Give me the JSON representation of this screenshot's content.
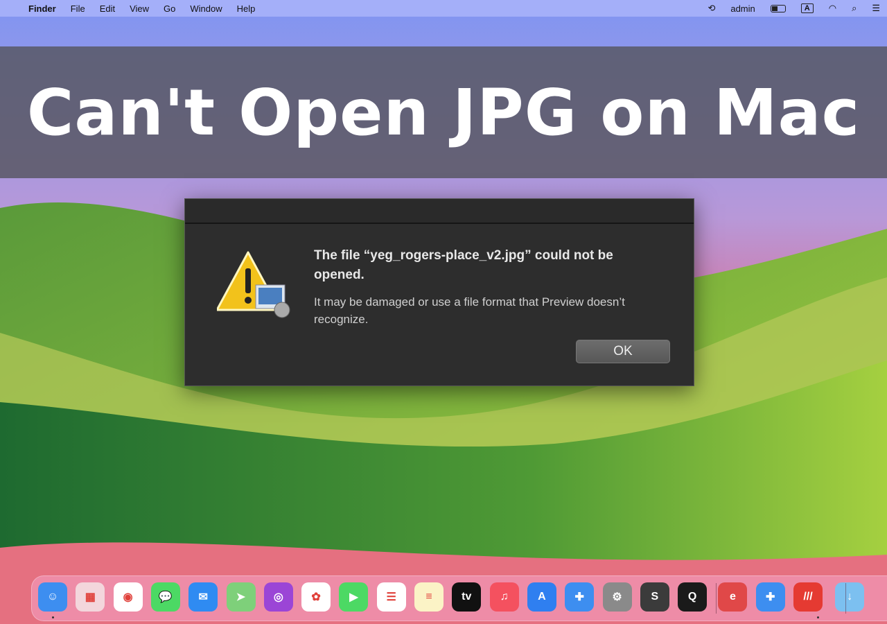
{
  "menubar": {
    "apple": "",
    "app": "Finder",
    "items": [
      "File",
      "Edit",
      "View",
      "Go",
      "Window",
      "Help"
    ],
    "user": "admin",
    "input_source": "A"
  },
  "banner": {
    "title": "Can't Open JPG on Mac"
  },
  "dialog": {
    "title": "The file “yeg_rogers-place_v2.jpg” could not be opened.",
    "message": "It may be damaged or use a file format that Preview doesn’t recognize.",
    "ok_label": "OK"
  },
  "dock": {
    "apps": [
      {
        "name": "finder",
        "color": "#3d8ef0",
        "glyph": "☺"
      },
      {
        "name": "launchpad",
        "color": "#f3d6dc",
        "glyph": "▦"
      },
      {
        "name": "chrome",
        "color": "#ffffff",
        "glyph": "◉"
      },
      {
        "name": "messages",
        "color": "#4cd964",
        "glyph": "💬"
      },
      {
        "name": "mail",
        "color": "#2f8bf2",
        "glyph": "✉"
      },
      {
        "name": "maps",
        "color": "#7ed07a",
        "glyph": "➤"
      },
      {
        "name": "podcasts",
        "color": "#9b45d6",
        "glyph": "◎"
      },
      {
        "name": "photos",
        "color": "#ffffff",
        "glyph": "✿"
      },
      {
        "name": "facetime",
        "color": "#4cd964",
        "glyph": "▶"
      },
      {
        "name": "reminders",
        "color": "#ffffff",
        "glyph": "☰"
      },
      {
        "name": "notes",
        "color": "#fbf3c6",
        "glyph": "≡"
      },
      {
        "name": "apple-tv",
        "color": "#111111",
        "glyph": "tv"
      },
      {
        "name": "music",
        "color": "#f4515f",
        "glyph": "♫"
      },
      {
        "name": "app-store",
        "color": "#2f7ff0",
        "glyph": "A"
      },
      {
        "name": "toolbox",
        "color": "#3d8ef0",
        "glyph": "✚"
      },
      {
        "name": "system-settings",
        "color": "#8a8a8a",
        "glyph": "⚙"
      },
      {
        "name": "sublime-text",
        "color": "#3b3b3b",
        "glyph": "S"
      },
      {
        "name": "quicktime",
        "color": "#1a1a1a",
        "glyph": "Q"
      },
      {
        "name": "easeus",
        "color": "#e04848",
        "glyph": "e"
      },
      {
        "name": "toolbox-2",
        "color": "#3d8ef0",
        "glyph": "✚"
      },
      {
        "name": "recovery",
        "color": "#e53a32",
        "glyph": "///"
      },
      {
        "name": "downloads",
        "color": "#7cc0f0",
        "glyph": "↓"
      }
    ]
  }
}
